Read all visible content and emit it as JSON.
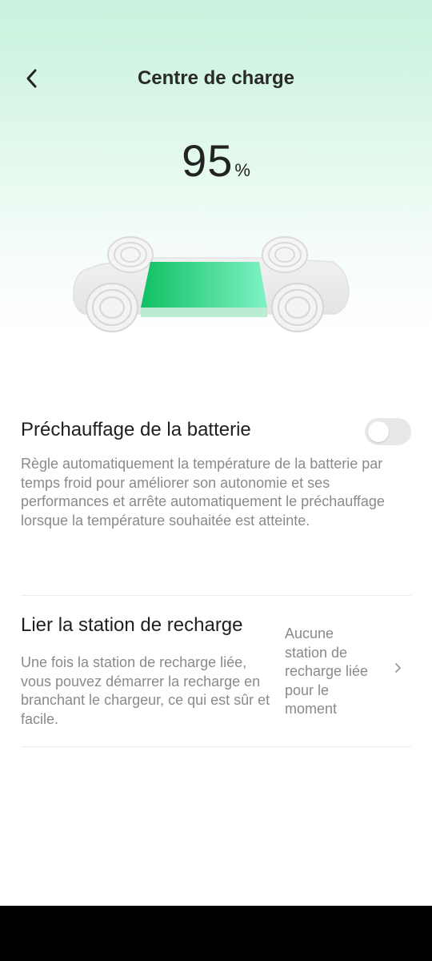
{
  "header": {
    "back_icon": "chevron-left-icon",
    "title": "Centre de charge"
  },
  "battery": {
    "level": "95",
    "unit": "%",
    "fill_fraction": 0.95,
    "colors": {
      "fill_start": "#0fc063",
      "fill_end": "#7ff2c4"
    }
  },
  "preheat": {
    "title": "Préchauffage de la batterie",
    "description": "Règle automatiquement la température de la batterie par temps froid pour améliorer son autonomie et ses performances et arrête automatiquement le préchauffage lorsque la température souhaitée est atteinte.",
    "toggle_on": false
  },
  "charging_station": {
    "title": "Lier la station de recharge",
    "description": "Une fois la station de recharge liée, vous pouvez démarrer la recharge en branchant le chargeur, ce qui est sûr et facile.",
    "status": "Aucune station de recharge liée pour le moment",
    "chevron_icon": "chevron-right-icon"
  }
}
